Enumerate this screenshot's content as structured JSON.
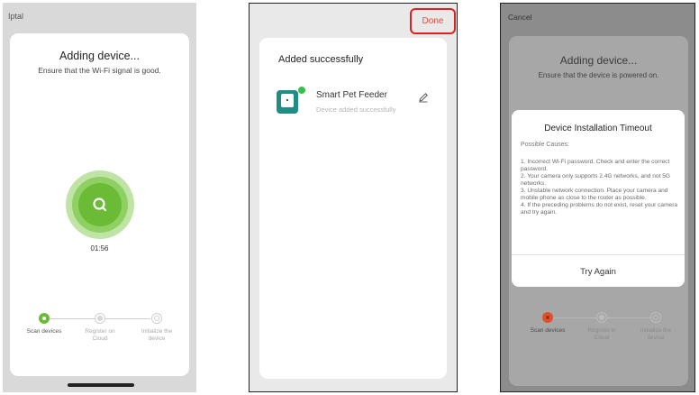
{
  "screen1": {
    "status_text": "Iptal",
    "title": "Adding device...",
    "subtitle": "Ensure that the Wi-Fi signal is good.",
    "timer": "01:56",
    "steps": [
      {
        "label": "Scan devices"
      },
      {
        "label": "Register on Cloud"
      },
      {
        "label": "Initialize the device"
      }
    ],
    "colors": {
      "accent": "#6bbb37",
      "ring_light": "#bfe4a6"
    }
  },
  "screen2": {
    "done_label": "Done",
    "heading": "Added successfully",
    "device_name": "Smart Pet Feeder",
    "device_status": "Device added successfully",
    "colors": {
      "done": "#e84a3b",
      "device_icon": "#1f8d86"
    }
  },
  "screen3": {
    "cancel_label": "Cancel",
    "title": "Adding device...",
    "subtitle": "Ensure that the device is powered on.",
    "dialog": {
      "title": "Device Installation Timeout",
      "causes_label": "Possible Causes:",
      "causes": [
        "1. Incorrect Wi-Fi password. Check and enter the correct password.",
        "2. Your camera only supports 2.4G networks, and not 5G networks.",
        "3. Unstable network connection. Place your camera and mobile phone as close to the router as possible.",
        "4. If the preceding problems do not exist, reset your camera and try again."
      ],
      "button": "Try Again"
    },
    "steps": [
      {
        "label": "Scan devices"
      },
      {
        "label": "Register in Cloud"
      },
      {
        "label": "Initialize the device"
      }
    ],
    "colors": {
      "step_active": "#e0502a"
    }
  }
}
